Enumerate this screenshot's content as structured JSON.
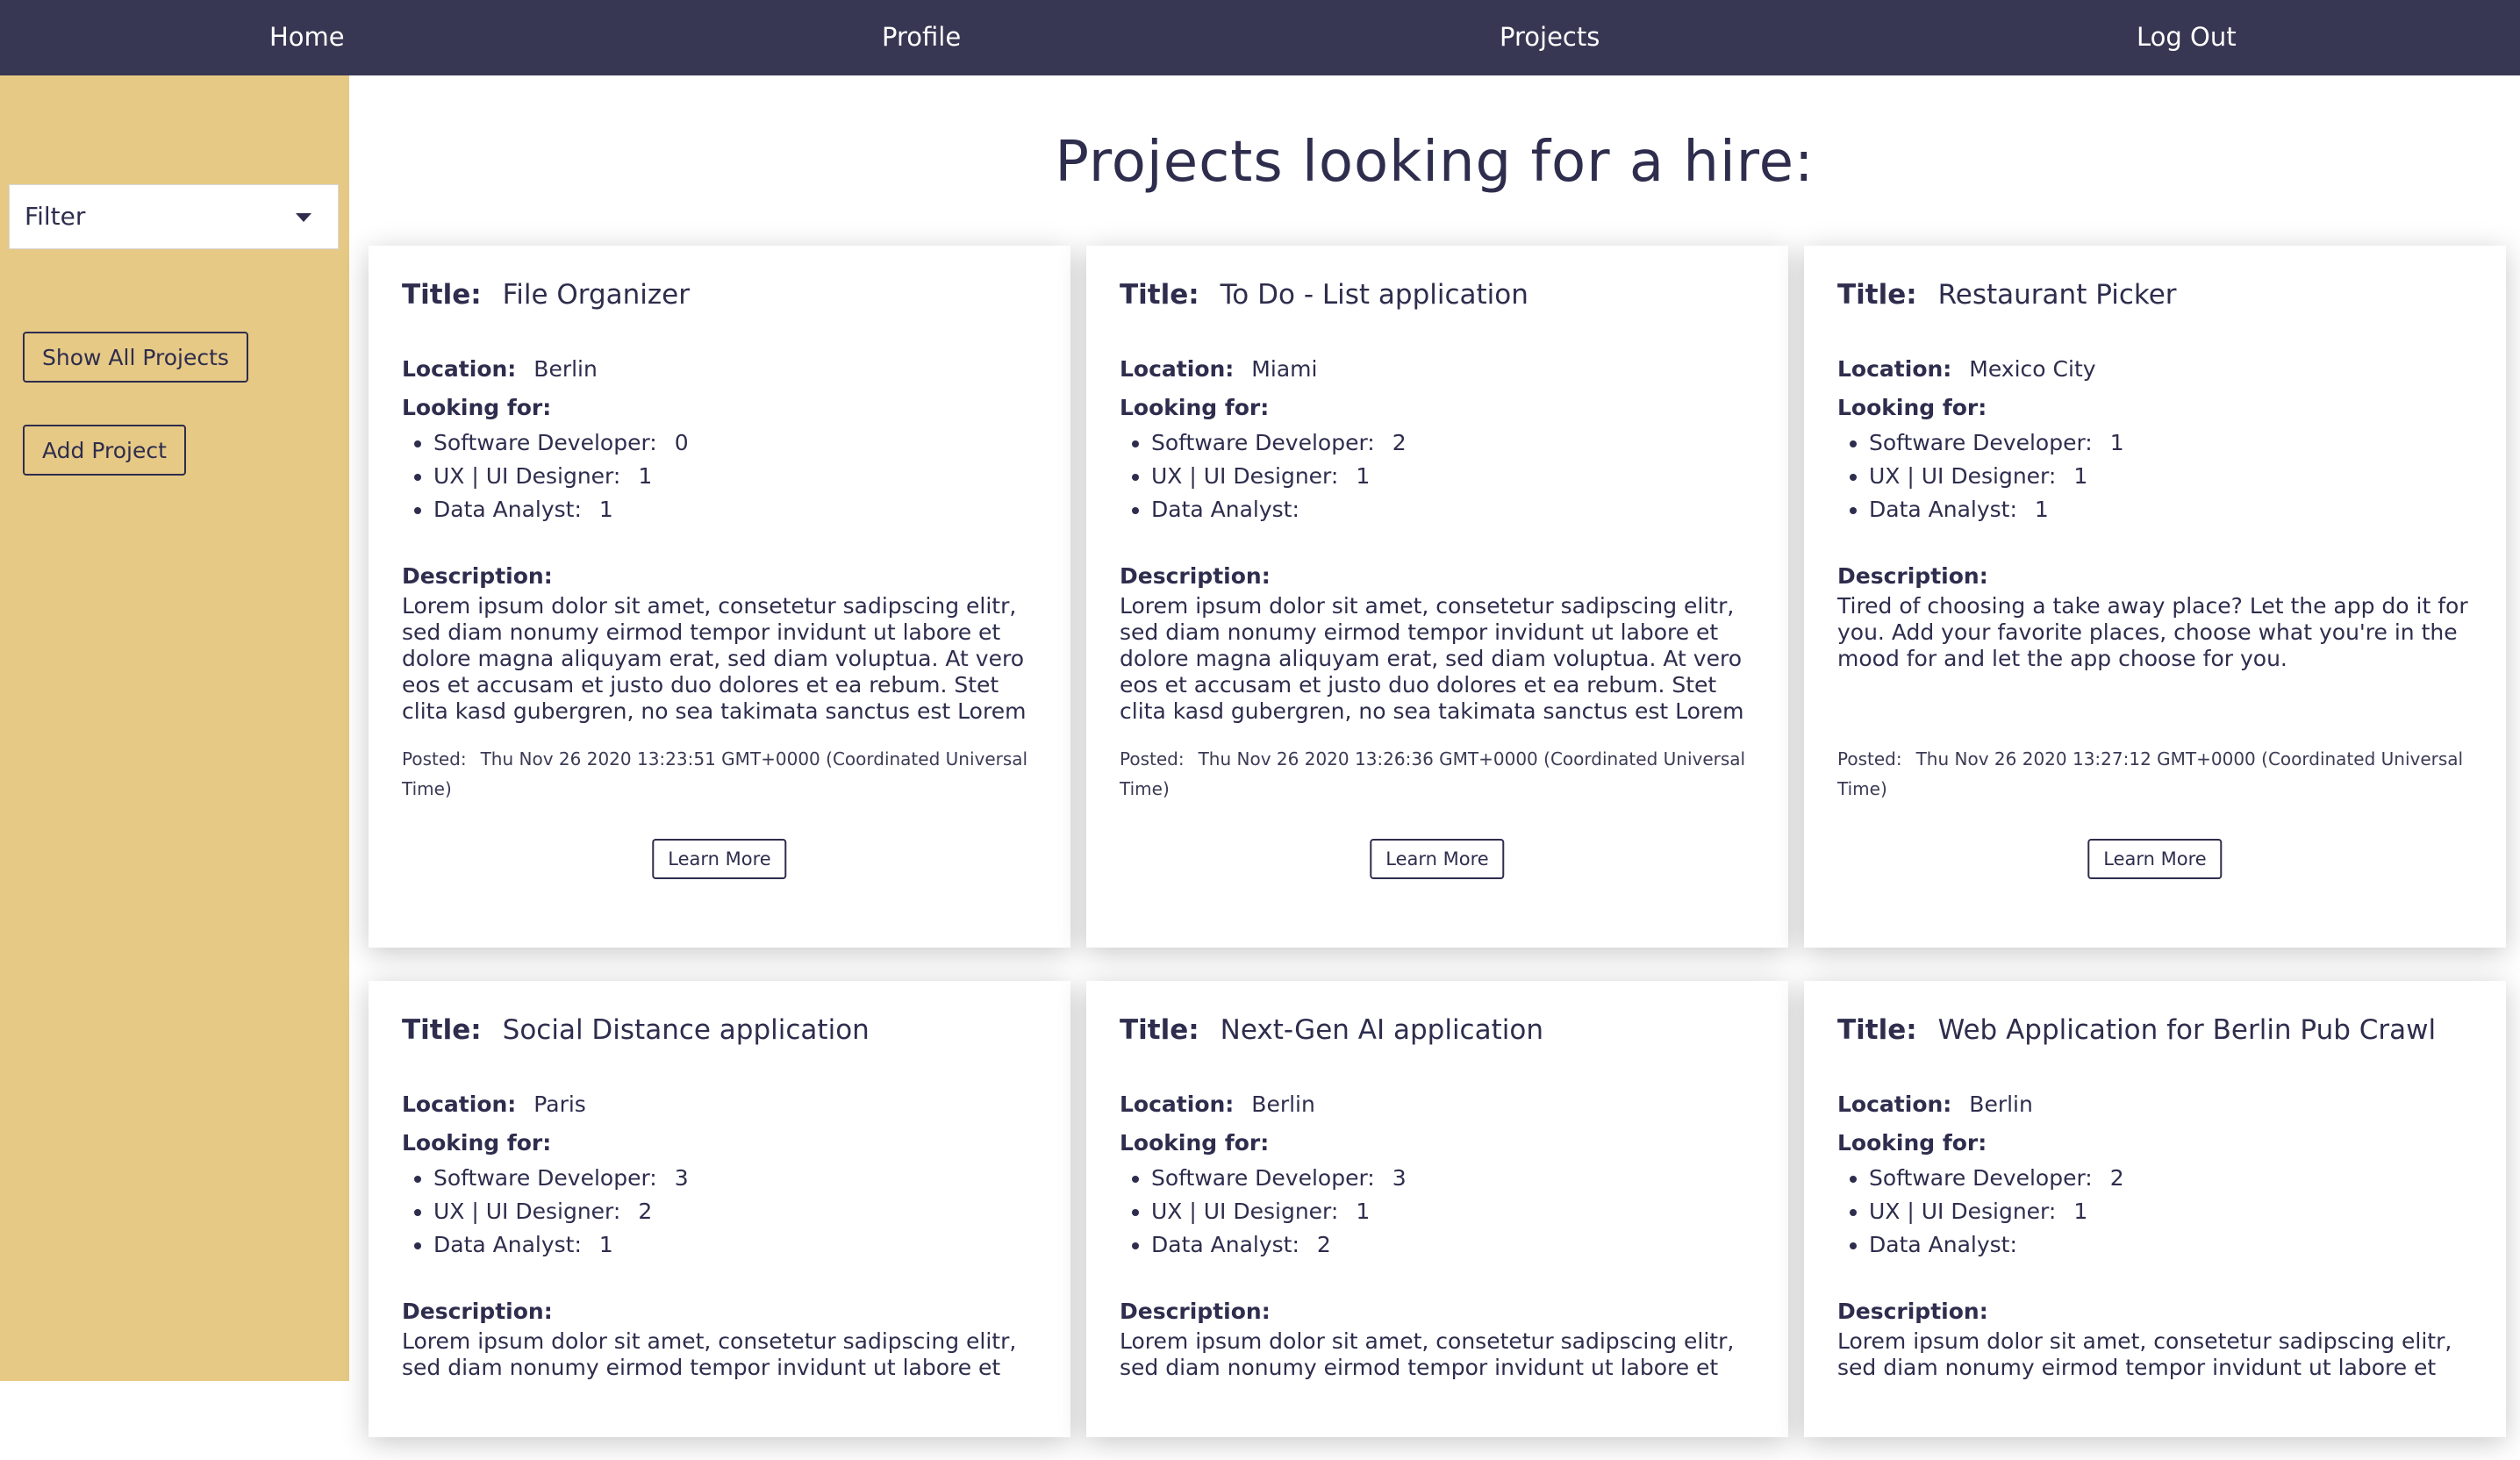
{
  "nav": {
    "home": "Home",
    "profile": "Profile",
    "projects": "Projects",
    "logout": "Log Out"
  },
  "sidebar": {
    "filter_label": "Filter",
    "show_all": "Show All Projects",
    "add_project": "Add Project"
  },
  "page_title": "Projects looking for a hire:",
  "labels": {
    "title": "Title:",
    "location": "Location:",
    "looking_for": "Looking for:",
    "software_developer": "Software Developer:",
    "ux_ui_designer": "UX | UI Designer:",
    "data_analyst": "Data Analyst:",
    "description": "Description:",
    "posted": "Posted:",
    "learn_more": "Learn More"
  },
  "projects": [
    {
      "title": "File Organizer",
      "location": "Berlin",
      "software_developer": "0",
      "ux_ui_designer": "1",
      "data_analyst": "1",
      "description": "Lorem ipsum dolor sit amet, consetetur sadipscing elitr, sed diam nonumy eirmod tempor invidunt ut labore et dolore magna aliquyam erat, sed diam voluptua. At vero eos et accusam et justo duo dolores et ea rebum. Stet clita kasd gubergren, no sea takimata sanctus est Lorem ipsum dolor sit amet.",
      "posted": "Thu Nov 26 2020 13:23:51 GMT+0000 (Coordinated Universal Time)"
    },
    {
      "title": "To Do - List application",
      "location": "Miami",
      "software_developer": "2",
      "ux_ui_designer": "1",
      "data_analyst": "",
      "description": "Lorem ipsum dolor sit amet, consetetur sadipscing elitr, sed diam nonumy eirmod tempor invidunt ut labore et dolore magna aliquyam erat, sed diam voluptua. At vero eos et accusam et justo duo dolores et ea rebum. Stet clita kasd gubergren, no sea takimata sanctus est Lorem ipsum dolor sit amet.",
      "posted": "Thu Nov 26 2020 13:26:36 GMT+0000 (Coordinated Universal Time)"
    },
    {
      "title": "Restaurant Picker",
      "location": "Mexico City",
      "software_developer": "1",
      "ux_ui_designer": "1",
      "data_analyst": "1",
      "description": "Tired of choosing a take away place? Let the app do it for you. Add your favorite places, choose what you're in the mood for and let the app choose for you.",
      "posted": "Thu Nov 26 2020 13:27:12 GMT+0000 (Coordinated Universal Time)"
    },
    {
      "title": "Social Distance application",
      "location": "Paris",
      "software_developer": "3",
      "ux_ui_designer": "2",
      "data_analyst": "1",
      "description": "Lorem ipsum dolor sit amet, consetetur sadipscing elitr, sed diam nonumy eirmod tempor invidunt ut labore et"
    },
    {
      "title": "Next-Gen AI application",
      "location": "Berlin",
      "software_developer": "3",
      "ux_ui_designer": "1",
      "data_analyst": "2",
      "description": "Lorem ipsum dolor sit amet, consetetur sadipscing elitr, sed diam nonumy eirmod tempor invidunt ut labore et"
    },
    {
      "title": "Web Application for Berlin Pub Crawl",
      "location": "Berlin",
      "software_developer": "2",
      "ux_ui_designer": "1",
      "data_analyst": "",
      "description": "Lorem ipsum dolor sit amet, consetetur sadipscing elitr, sed diam nonumy eirmod tempor invidunt ut labore et"
    }
  ]
}
